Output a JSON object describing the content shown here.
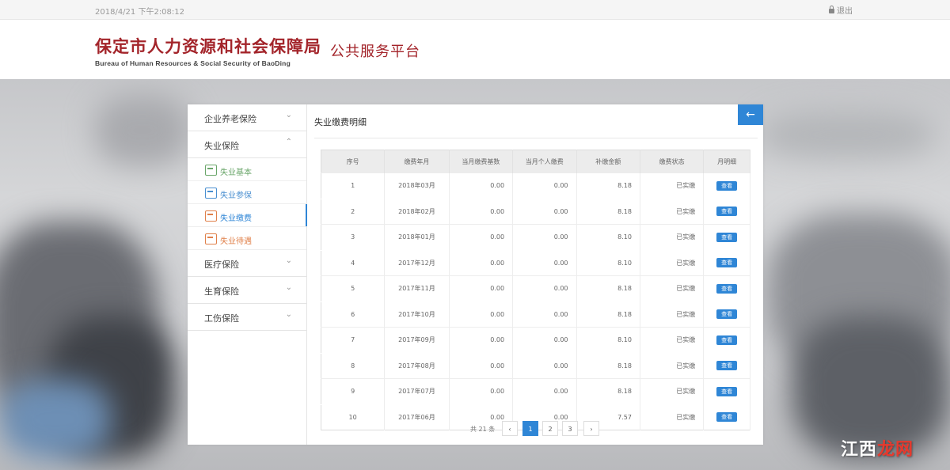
{
  "topbar": {
    "datetime": "2018/4/21 下午2:08:12",
    "logout_label": "退出"
  },
  "header": {
    "bureau_cn": "保定市人力资源和社会保障局",
    "bureau_en": "Bureau of Human Resources & Social Security of BaoDing",
    "platform": "公共服务平台"
  },
  "sidebar": {
    "groups": [
      {
        "label": "企业养老保险"
      },
      {
        "label": "失业保险"
      },
      {
        "label": "医疗保险"
      },
      {
        "label": "生育保险"
      },
      {
        "label": "工伤保险"
      }
    ],
    "sub_items": [
      {
        "label": "失业基本",
        "icon": "user-info-icon"
      },
      {
        "label": "失业参保",
        "icon": "insured-icon"
      },
      {
        "label": "失业缴费",
        "icon": "payment-icon"
      },
      {
        "label": "失业待遇",
        "icon": "benefit-icon"
      }
    ]
  },
  "content": {
    "title": "失业缴费明细",
    "back_icon": "←",
    "columns": [
      "序号",
      "缴费年月",
      "当月缴费基数",
      "当月个人缴费",
      "补缴金额",
      "缴费状态",
      "月明细"
    ],
    "rows": [
      [
        "1",
        "2018年03月",
        "0.00",
        "0.00",
        "8.18",
        "已实缴",
        "查看"
      ],
      [
        "2",
        "2018年02月",
        "0.00",
        "0.00",
        "8.18",
        "已实缴",
        "查看"
      ],
      [
        "3",
        "2018年01月",
        "0.00",
        "0.00",
        "8.10",
        "已实缴",
        "查看"
      ],
      [
        "4",
        "2017年12月",
        "0.00",
        "0.00",
        "8.10",
        "已实缴",
        "查看"
      ],
      [
        "5",
        "2017年11月",
        "0.00",
        "0.00",
        "8.18",
        "已实缴",
        "查看"
      ],
      [
        "6",
        "2017年10月",
        "0.00",
        "0.00",
        "8.18",
        "已实缴",
        "查看"
      ],
      [
        "7",
        "2017年09月",
        "0.00",
        "0.00",
        "8.10",
        "已实缴",
        "查看"
      ],
      [
        "8",
        "2017年08月",
        "0.00",
        "0.00",
        "8.18",
        "已实缴",
        "查看"
      ],
      [
        "9",
        "2017年07月",
        "0.00",
        "0.00",
        "8.18",
        "已实缴",
        "查看"
      ],
      [
        "10",
        "2017年06月",
        "0.00",
        "0.00",
        "7.57",
        "已实缴",
        "查看"
      ]
    ],
    "pager": {
      "total": "共 21 条",
      "prev": "‹",
      "pages": [
        "1",
        "2",
        "3"
      ],
      "next": "›",
      "current": "1"
    }
  },
  "watermark": {
    "part1": "江西",
    "part2": "龙网"
  },
  "colors": {
    "accent": "#2f86d6",
    "brand_red": "#a3242a"
  }
}
